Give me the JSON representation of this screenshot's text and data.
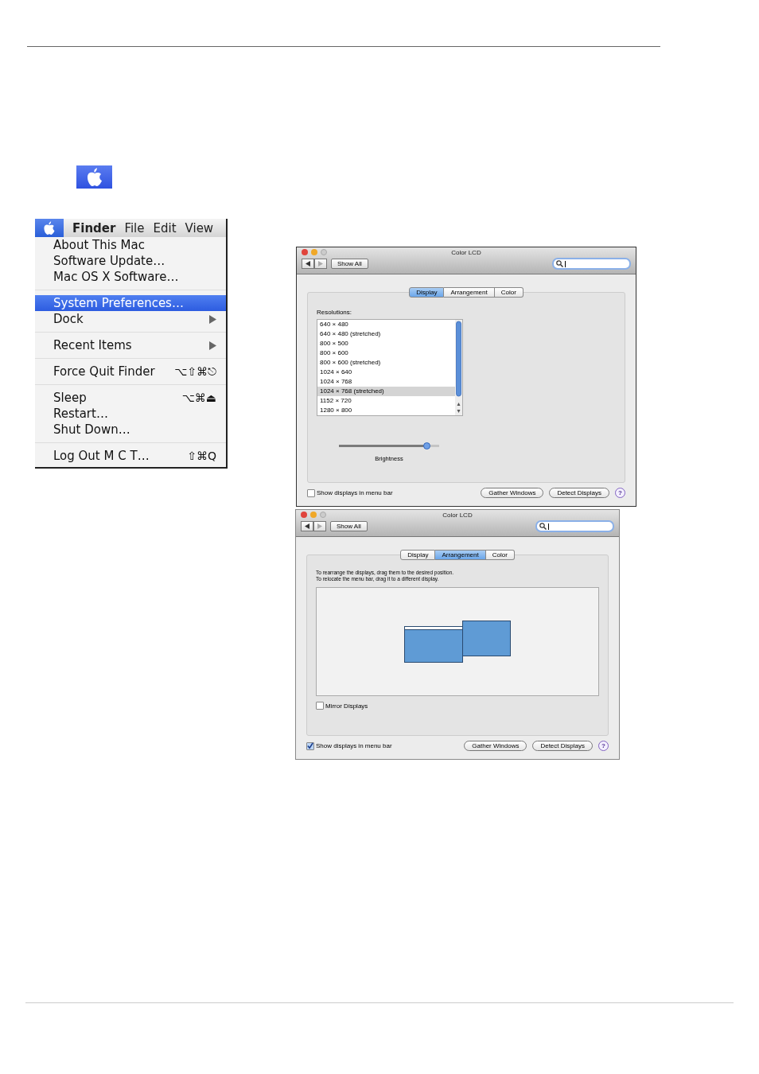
{
  "menu_bar": {
    "apple_selected": true,
    "items": [
      {
        "label": "Finder",
        "kind": "app"
      },
      {
        "label": "File",
        "kind": "menu"
      },
      {
        "label": "Edit",
        "kind": "menu"
      },
      {
        "label": "View",
        "kind": "menu"
      }
    ]
  },
  "apple_menu": {
    "groups": [
      [
        {
          "label": "About This Mac",
          "submenu": false,
          "selected": false
        },
        {
          "label": "Software Update…",
          "submenu": false,
          "selected": false
        },
        {
          "label": "Mac OS X Software…",
          "submenu": false,
          "selected": false
        }
      ],
      [
        {
          "label": "System Preferences…",
          "submenu": false,
          "selected": true
        },
        {
          "label": "Dock",
          "submenu": true,
          "selected": false
        }
      ],
      [
        {
          "label": "Recent Items",
          "submenu": true,
          "selected": false
        }
      ],
      [
        {
          "label": "Force Quit Finder",
          "shortcut": "⌥⇧⌘⎋",
          "submenu": false,
          "selected": false
        }
      ],
      [
        {
          "label": "Sleep",
          "shortcut": "⌥⌘⏏",
          "submenu": false,
          "selected": false
        },
        {
          "label": "Restart…",
          "submenu": false,
          "selected": false
        },
        {
          "label": "Shut Down…",
          "submenu": false,
          "selected": false
        }
      ],
      [
        {
          "label": "Log Out M C T…",
          "shortcut": "⇧⌘Q",
          "submenu": false,
          "selected": false
        }
      ]
    ]
  },
  "windows": [
    {
      "kind": "display",
      "title": "Color LCD",
      "show_all": "Show All",
      "tabs": [
        {
          "label": "Display",
          "selected": true
        },
        {
          "label": "Arrangement",
          "selected": false
        },
        {
          "label": "Color",
          "selected": false
        }
      ],
      "resolutions_label": "Resolutions:",
      "resolutions": [
        {
          "label": "640 × 480",
          "selected": false
        },
        {
          "label": "640 × 480 (stretched)",
          "selected": false
        },
        {
          "label": "800 × 500",
          "selected": false
        },
        {
          "label": "800 × 600",
          "selected": false
        },
        {
          "label": "800 × 600 (stretched)",
          "selected": false
        },
        {
          "label": "1024 × 640",
          "selected": false
        },
        {
          "label": "1024 × 768",
          "selected": false
        },
        {
          "label": "1024 × 768 (stretched)",
          "selected": true
        },
        {
          "label": "1152 × 720",
          "selected": false
        },
        {
          "label": "1280 × 800",
          "selected": false
        }
      ],
      "brightness": {
        "label": "Brightness",
        "level": 0.88
      },
      "menu_bar_checkbox": {
        "label": "Show displays in menu bar",
        "checked": false
      },
      "buttons": [
        "Gather Windows",
        "Detect Displays"
      ],
      "help": "?"
    },
    {
      "kind": "arrangement",
      "title": "Color LCD",
      "show_all": "Show All",
      "tabs": [
        {
          "label": "Display",
          "selected": false
        },
        {
          "label": "Arrangement",
          "selected": true
        },
        {
          "label": "Color",
          "selected": false
        }
      ],
      "instructions": [
        "To rearrange the displays, drag them to the desired position.",
        "To relocate the menu bar, drag it to a different display."
      ],
      "mirror_checkbox": {
        "label": "Mirror Displays",
        "checked": false
      },
      "menu_bar_checkbox": {
        "label": "Show displays in menu bar",
        "checked": true
      },
      "buttons": [
        "Gather Windows",
        "Detect Displays"
      ],
      "help": "?"
    }
  ]
}
